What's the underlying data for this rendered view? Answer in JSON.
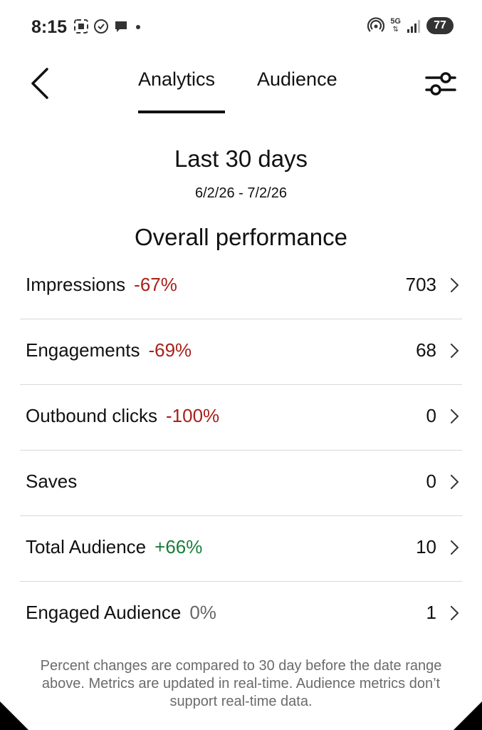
{
  "status_bar": {
    "time": "8:15",
    "network": "5G",
    "battery": "77"
  },
  "header": {
    "tabs": [
      {
        "label": "Analytics",
        "active": true
      },
      {
        "label": "Audience",
        "active": false
      }
    ]
  },
  "range": {
    "title": "Last 30 days",
    "dates": "6/2/26 - 7/2/26"
  },
  "section_title": "Overall performance",
  "metrics": [
    {
      "label": "Impressions",
      "change": "-67%",
      "trend": "neg",
      "value": "703"
    },
    {
      "label": "Engagements",
      "change": "-69%",
      "trend": "neg",
      "value": "68"
    },
    {
      "label": "Outbound clicks",
      "change": "-100%",
      "trend": "neg",
      "value": "0"
    },
    {
      "label": "Saves",
      "change": "",
      "trend": "none",
      "value": "0"
    },
    {
      "label": "Total Audience",
      "change": "+66%",
      "trend": "pos",
      "value": "10"
    },
    {
      "label": "Engaged Audience",
      "change": "0%",
      "trend": "neutral",
      "value": "1"
    }
  ],
  "footnote": "Percent changes are compared to 30 day before the date range above. Metrics are updated in real-time. Audience metrics don’t support real-time data.",
  "colors": {
    "negative": "#a8201a",
    "positive": "#1b7d3a",
    "neutral": "#666666"
  },
  "icons": [
    "back-arrow-icon",
    "filter-sliders-icon",
    "chevron-right-icon"
  ]
}
